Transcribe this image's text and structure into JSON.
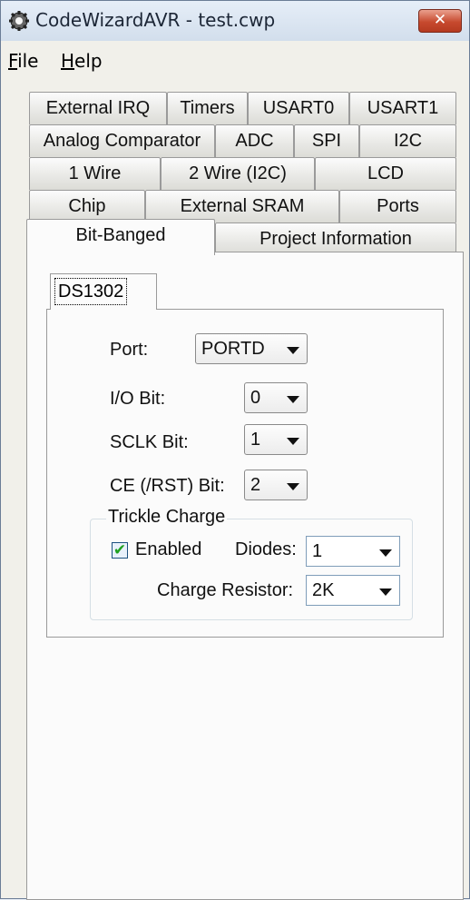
{
  "window": {
    "title": "CodeWizardAVR - test.cwp",
    "close_glyph": "✕"
  },
  "menu": {
    "file": {
      "u": "F",
      "rest": "ile"
    },
    "help": {
      "u": "H",
      "rest": "elp"
    }
  },
  "tabs": {
    "row1": [
      "External IRQ",
      "Timers",
      "USART0",
      "USART1"
    ],
    "row2": [
      "Analog Comparator",
      "ADC",
      "SPI",
      "I2C"
    ],
    "row3": [
      "1 Wire",
      "2 Wire (I2C)",
      "LCD"
    ],
    "row4": [
      "Chip",
      "External SRAM",
      "Ports"
    ],
    "row5": [
      "Bit-Banged",
      "Project Information"
    ]
  },
  "subtab": {
    "label": "DS1302"
  },
  "form": {
    "port_label": "Port:",
    "port_value": "PORTD",
    "io_label": "I/O Bit:",
    "io_value": "0",
    "sclk_label": "SCLK Bit:",
    "sclk_value": "1",
    "ce_label": "CE (/RST) Bit:",
    "ce_value": "2"
  },
  "trickle": {
    "title": "Trickle Charge",
    "enabled_label": "Enabled",
    "enabled_checked": true,
    "check_glyph": "✔",
    "diodes_label": "Diodes:",
    "diodes_value": "1",
    "resistor_label": "Charge Resistor:",
    "resistor_value": "2K"
  }
}
